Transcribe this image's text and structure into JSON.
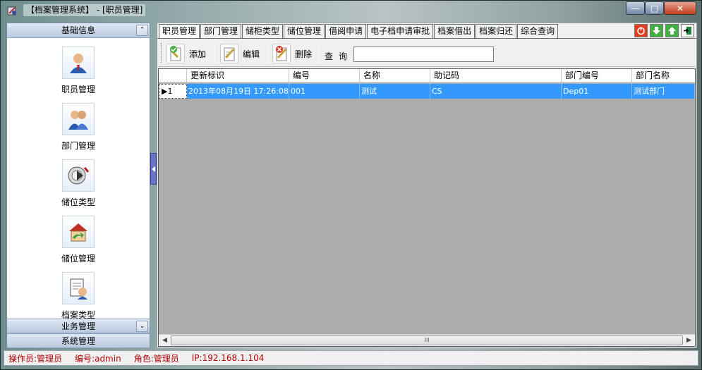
{
  "window": {
    "title": "【档案管理系统】 - [职员管理]",
    "controls": {
      "minimize": "—",
      "maximize": "□",
      "close": "✕"
    }
  },
  "sidebar": {
    "sections": [
      {
        "label": "基础信息",
        "toggle": "⌃"
      },
      {
        "label": "业务管理",
        "toggle": "⌄"
      },
      {
        "label": "系统管理"
      }
    ],
    "items": [
      {
        "label": "职员管理",
        "icon": "employee-icon"
      },
      {
        "label": "部门管理",
        "icon": "department-icon"
      },
      {
        "label": "储位类型",
        "icon": "storage-type-icon"
      },
      {
        "label": "储位管理",
        "icon": "storage-manage-icon"
      },
      {
        "label": "档案类型",
        "icon": "archive-type-icon"
      }
    ]
  },
  "tabs": [
    "职员管理",
    "部门管理",
    "储柜类型",
    "储位管理",
    "借阅申请",
    "电子档申请审批",
    "档案借出",
    "档案归还",
    "综合查询"
  ],
  "toolbar": {
    "add": "添加",
    "edit": "编辑",
    "delete": "删除",
    "query_label": "查询",
    "query_value": ""
  },
  "grid": {
    "columns": [
      "更新标识",
      "编号",
      "名称",
      "助记码",
      "部门编号",
      "部门名称"
    ],
    "rows": [
      {
        "indicator": "▶1",
        "cells": [
          "2013年08月19日 17:26:08",
          "001",
          "测试",
          "CS",
          "Dep01",
          "测试部门"
        ]
      }
    ],
    "scroll_grip": "III"
  },
  "status": {
    "operator": "操作员:管理员",
    "code": "编号:admin",
    "role": "角色:管理员",
    "ip": "IP:192.168.1.104"
  },
  "colors": {
    "selection": "#3399ff",
    "status_text": "#b00000",
    "grid_background": "#acacac"
  }
}
